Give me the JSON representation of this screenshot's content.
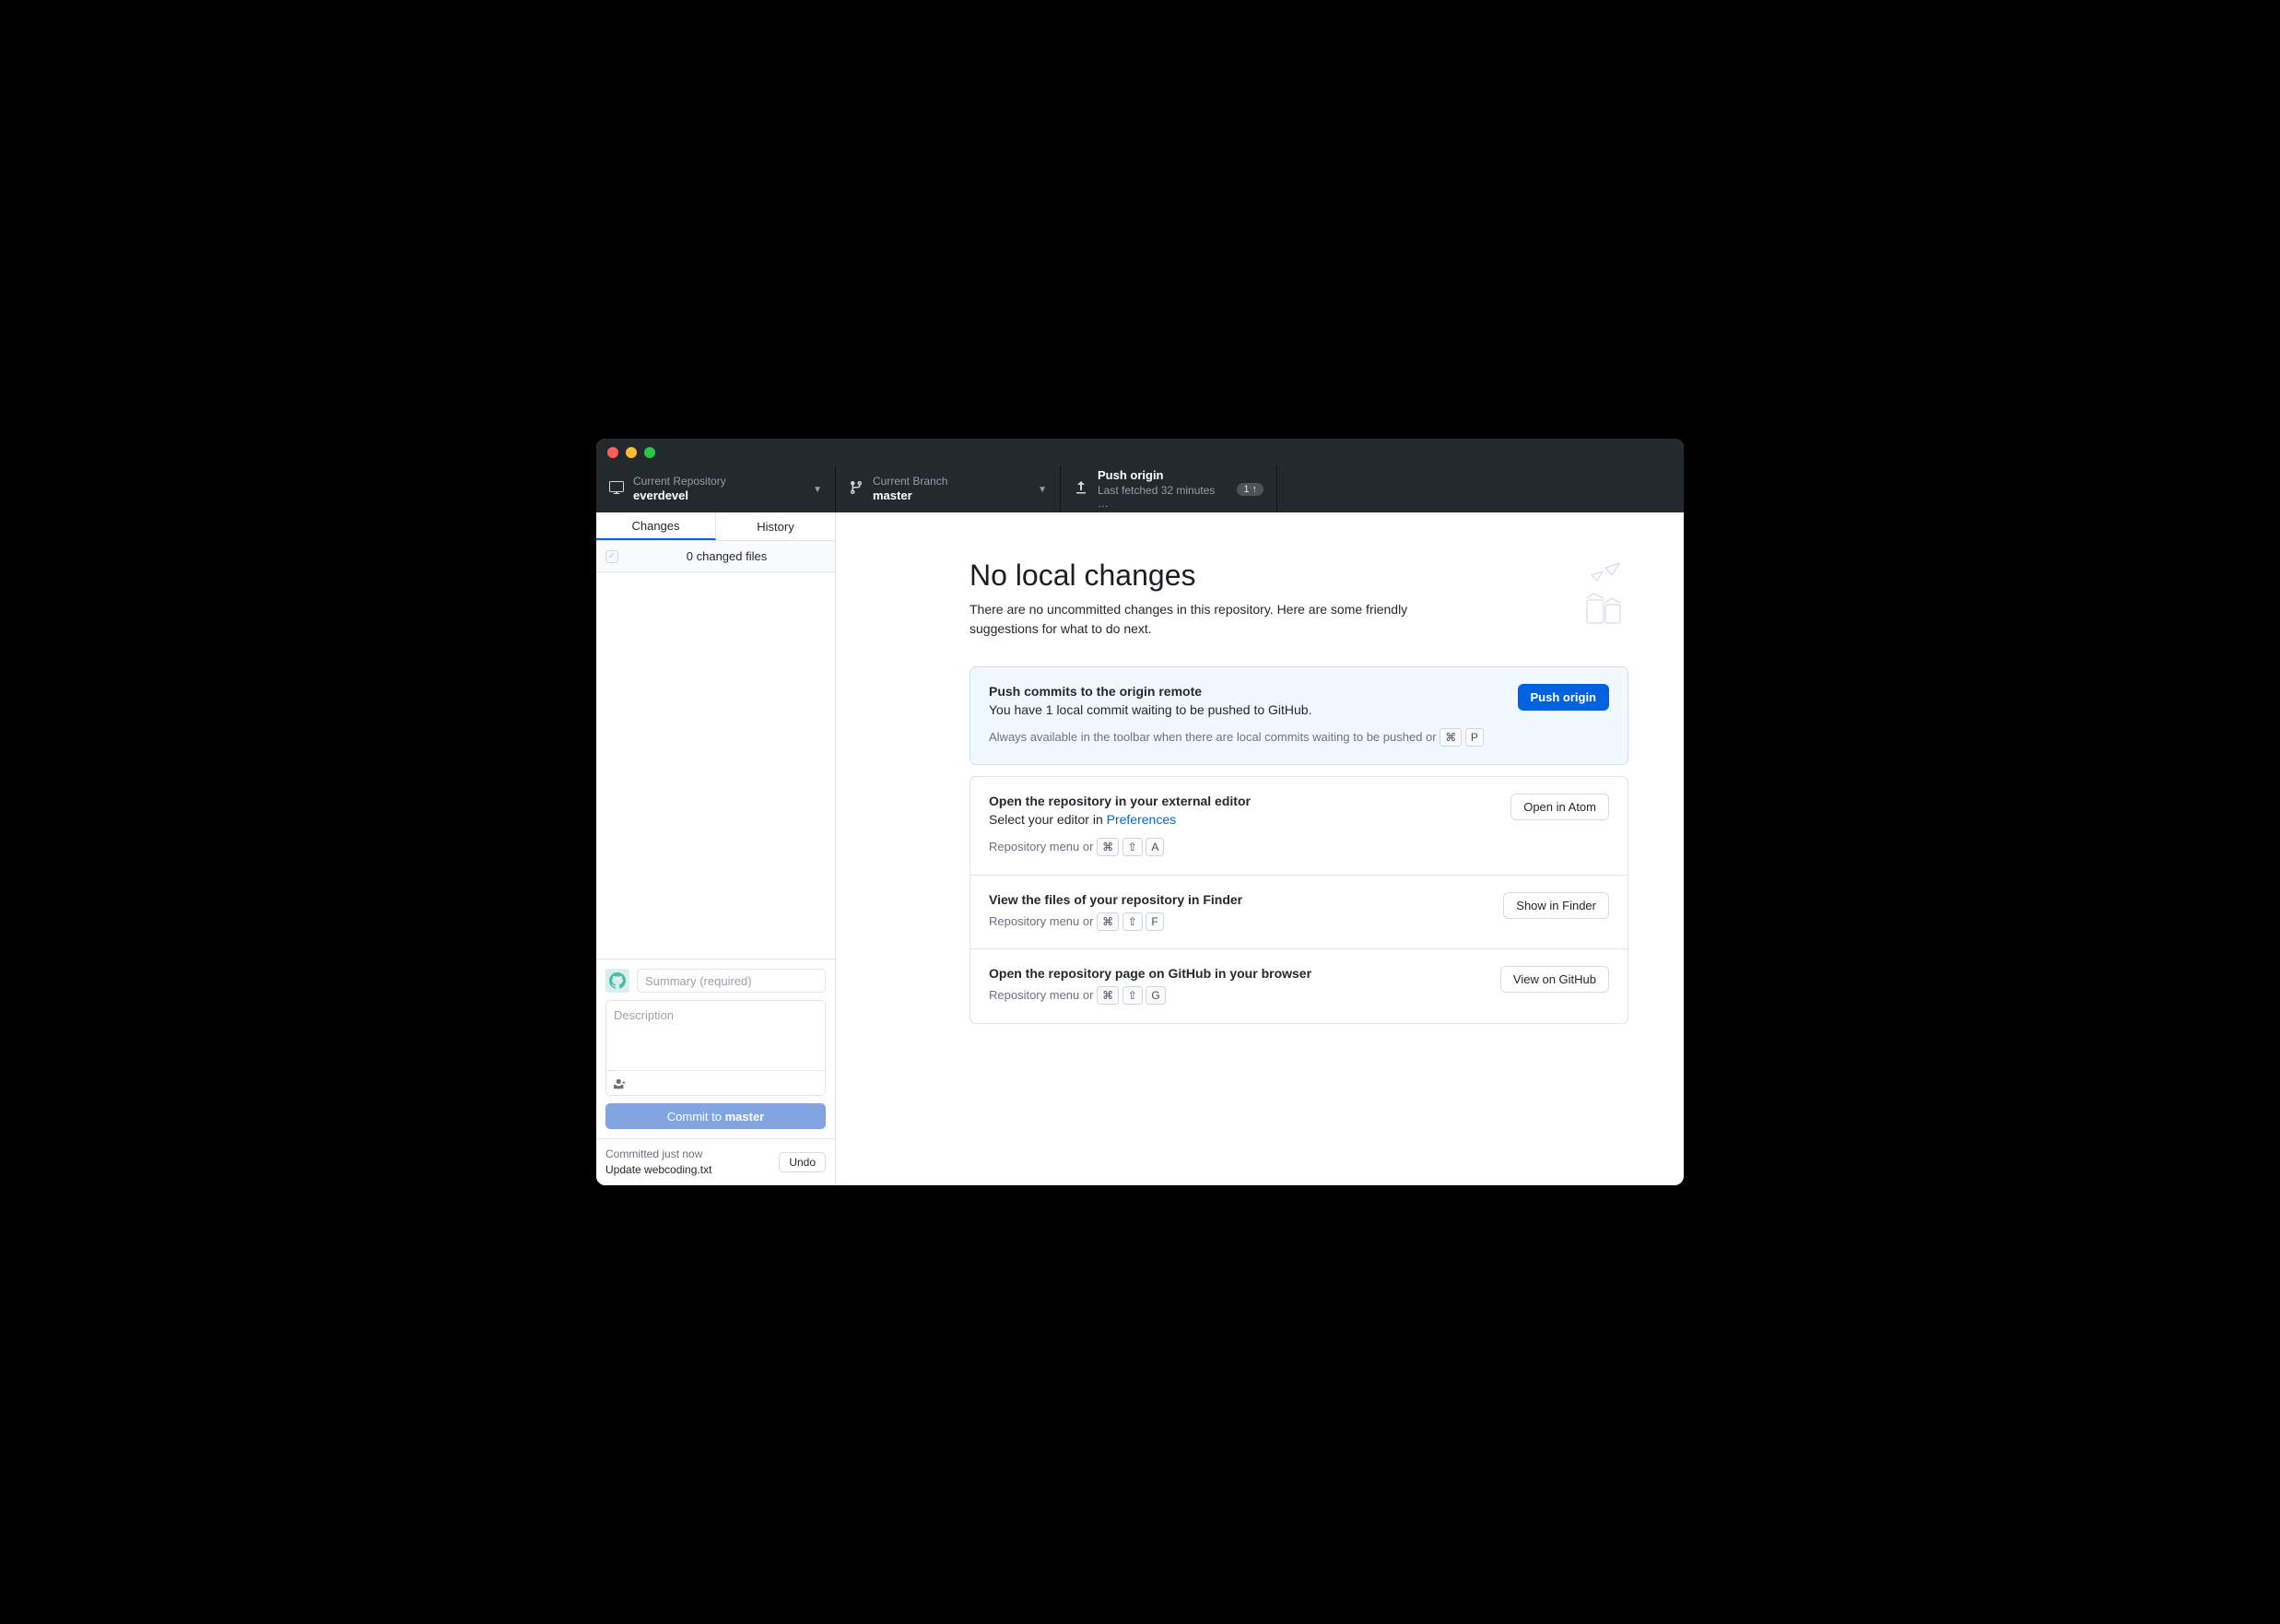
{
  "toolbar": {
    "repo": {
      "label": "Current Repository",
      "value": "everdevel"
    },
    "branch": {
      "label": "Current Branch",
      "value": "master"
    },
    "push": {
      "label": "Push origin",
      "value": "Last fetched 32 minutes …",
      "badge_count": "1"
    }
  },
  "sidebar": {
    "tabs": {
      "changes": "Changes",
      "history": "History"
    },
    "changes_count": "0 changed files",
    "commit": {
      "summary_placeholder": "Summary (required)",
      "description_placeholder": "Description",
      "button_prefix": "Commit to ",
      "button_branch": "master"
    },
    "last_commit": {
      "title": "Committed just now",
      "message": "Update webcoding.txt",
      "undo": "Undo"
    }
  },
  "main": {
    "heading": "No local changes",
    "subtitle": "There are no uncommitted changes in this repository. Here are some friendly suggestions for what to do next.",
    "cards": {
      "push": {
        "title": "Push commits to the origin remote",
        "desc": "You have 1 local commit waiting to be pushed to GitHub.",
        "hint_prefix": "Always available in the toolbar when there are local commits waiting to be pushed or ",
        "k1": "⌘",
        "k2": "P",
        "button": "Push origin"
      },
      "editor": {
        "title": "Open the repository in your external editor",
        "desc_prefix": "Select your editor in ",
        "desc_link": "Preferences",
        "hint_prefix": "Repository menu or ",
        "k1": "⌘",
        "k2": "⇧",
        "k3": "A",
        "button": "Open in Atom"
      },
      "finder": {
        "title": "View the files of your repository in Finder",
        "hint_prefix": "Repository menu or ",
        "k1": "⌘",
        "k2": "⇧",
        "k3": "F",
        "button": "Show in Finder"
      },
      "github": {
        "title": "Open the repository page on GitHub in your browser",
        "hint_prefix": "Repository menu or ",
        "k1": "⌘",
        "k2": "⇧",
        "k3": "G",
        "button": "View on GitHub"
      }
    }
  }
}
